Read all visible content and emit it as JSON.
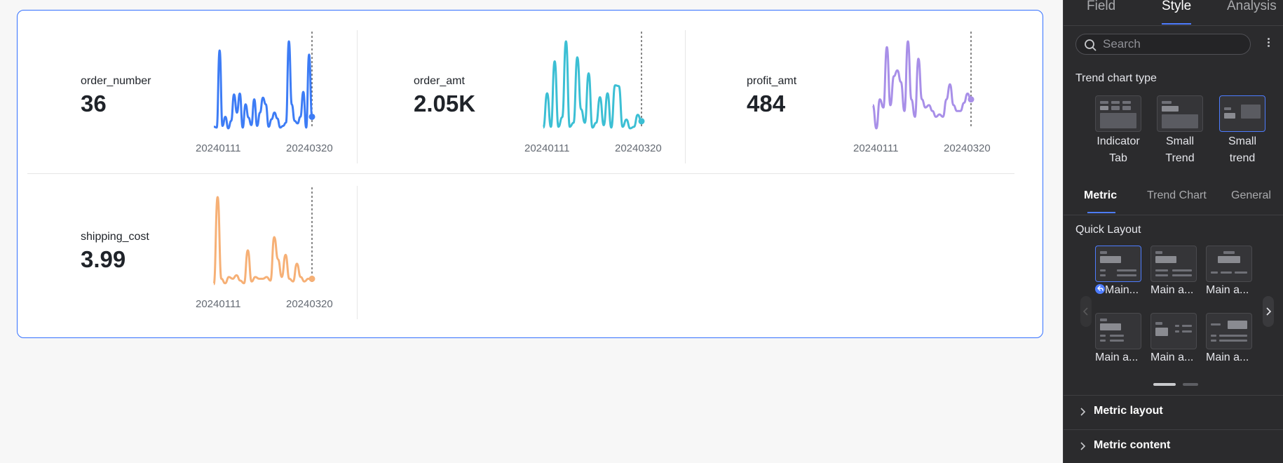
{
  "metrics": [
    {
      "name": "order_number",
      "value": "36",
      "color": "#3d7cf5",
      "date_start": "20240111",
      "date_end": "20240320",
      "trend": [
        3,
        2,
        95,
        4,
        15,
        1,
        10,
        42,
        20,
        43,
        2,
        30,
        14,
        5,
        36,
        4,
        20,
        38,
        30,
        3,
        12,
        20,
        13,
        2,
        4,
        8,
        106,
        30,
        10,
        7,
        15,
        45,
        2,
        90,
        15
      ]
    },
    {
      "name": "order_amt",
      "value": "2.05K",
      "color": "#3cbfd4",
      "date_start": "20240111",
      "date_end": "20240320",
      "trend": [
        2,
        45,
        3,
        85,
        3,
        15,
        110,
        3,
        8,
        90,
        25,
        8,
        70,
        2,
        8,
        40,
        5,
        45,
        2,
        55,
        54,
        3,
        12,
        1,
        3,
        18,
        10
      ]
    },
    {
      "name": "profit_amt",
      "value": "484",
      "color": "#a88fe8",
      "date_start": "20240111",
      "date_end": "20240320",
      "trend": [
        30,
        10,
        35,
        28,
        80,
        30,
        55,
        60,
        50,
        25,
        85,
        35,
        20,
        70,
        35,
        28,
        30,
        25,
        20,
        22,
        20,
        35,
        48,
        30,
        25,
        25,
        32,
        40,
        35
      ]
    },
    {
      "name": "shipping_cost",
      "value": "3.99",
      "color": "#f6b076",
      "date_start": "20240111",
      "date_end": "20240320",
      "trend": [
        2,
        100,
        8,
        3,
        10,
        8,
        12,
        6,
        3,
        40,
        5,
        10,
        8,
        8,
        10,
        6,
        55,
        30,
        10,
        35,
        8,
        5,
        25,
        10,
        5,
        8,
        8
      ]
    }
  ],
  "panel": {
    "tabs": {
      "field": "Field",
      "style": "Style",
      "analysis": "Analysis"
    },
    "search_placeholder": "Search",
    "trend_chart_type_label": "Trend chart type",
    "trend_types": [
      {
        "line1": "Indicator",
        "line2": "Tab"
      },
      {
        "line1": "Small",
        "line2": "Trend"
      },
      {
        "line1": "Small",
        "line2": "trend"
      }
    ],
    "subtabs": {
      "metric": "Metric",
      "trend_chart": "Trend Chart",
      "general": "General"
    },
    "quick_layout_label": "Quick Layout",
    "quick_layouts": [
      "Main...",
      "Main a...",
      "Main a...",
      "Main a...",
      "Main a...",
      "Main a..."
    ],
    "sections": {
      "metric_layout": "Metric layout",
      "metric_content": "Metric content"
    },
    "accent_color": "#4d7cff"
  }
}
